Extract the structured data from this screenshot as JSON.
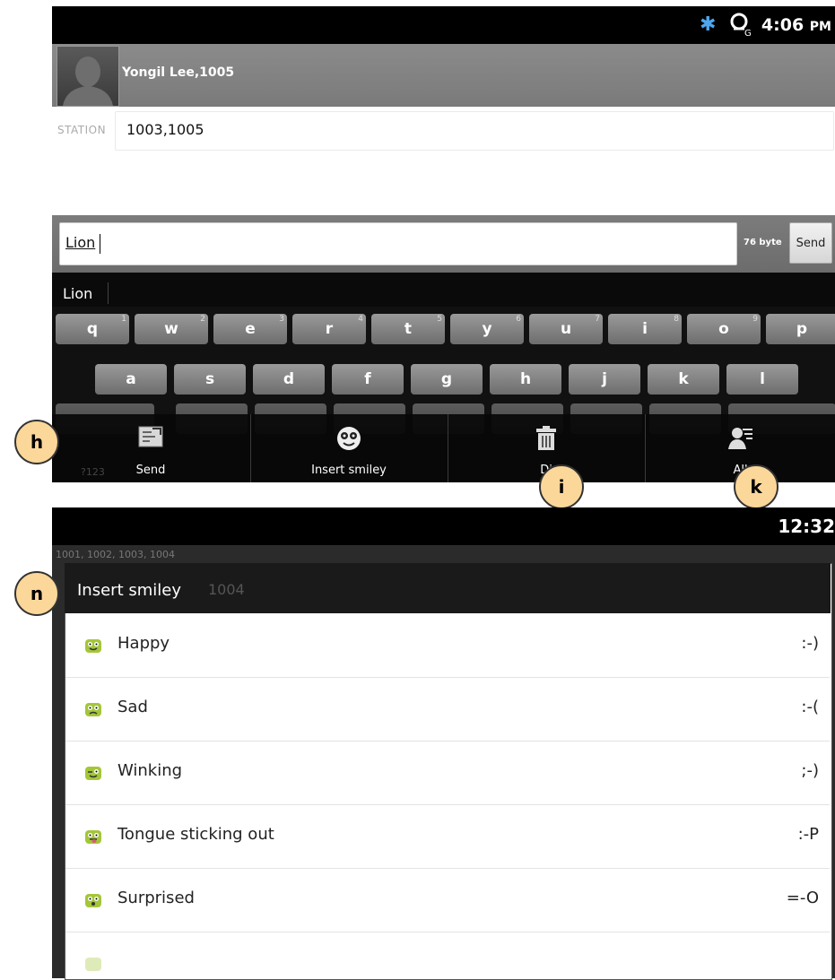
{
  "status_bar": {
    "time": "4:06",
    "ampm": "PM"
  },
  "contact": {
    "name": "Yongil Lee,1005"
  },
  "station": {
    "label": "STATION",
    "value": "1003,1005"
  },
  "compose": {
    "message": "Lion",
    "byte_count": "76 byte",
    "send_label": "Send"
  },
  "suggestion": {
    "word": "Lion"
  },
  "keyboard": {
    "row1": [
      {
        "key": "q",
        "num": "1"
      },
      {
        "key": "w",
        "num": "2"
      },
      {
        "key": "e",
        "num": "3"
      },
      {
        "key": "r",
        "num": "4"
      },
      {
        "key": "t",
        "num": "5"
      },
      {
        "key": "y",
        "num": "6"
      },
      {
        "key": "u",
        "num": "7"
      },
      {
        "key": "i",
        "num": "8"
      },
      {
        "key": "o",
        "num": "9"
      },
      {
        "key": "p",
        "num": ""
      }
    ],
    "row2": [
      "a",
      "s",
      "d",
      "f",
      "g",
      "h",
      "j",
      "k",
      "l"
    ],
    "symbols_key": "?123"
  },
  "options_menu": {
    "items": [
      {
        "label": "Send",
        "icon": "send-message-icon"
      },
      {
        "label": "Insert smiley",
        "icon": "smiley-icon"
      },
      {
        "label": "Di",
        "icon": "trash-icon"
      },
      {
        "label": "All",
        "icon": "contacts-icon"
      }
    ]
  },
  "callouts": {
    "h": "h",
    "i": "i",
    "k": "k",
    "n": "n"
  },
  "status_bar_2": {
    "time": "12:32"
  },
  "background_hint": {
    "recipients": "1001, 1002, 1003, 1004",
    "recipients_field": "1004"
  },
  "smiley_dialog": {
    "title": "Insert smiley",
    "items": [
      {
        "name": "Happy",
        "code": ":-)"
      },
      {
        "name": "Sad",
        "code": ":-("
      },
      {
        "name": "Winking",
        "code": ";-)"
      },
      {
        "name": "Tongue sticking out",
        "code": ":-P"
      },
      {
        "name": "Surprised",
        "code": "=-O"
      }
    ]
  },
  "colors": {
    "accent_blue": "#4fa6ee",
    "callout_fill": "#fcd79a",
    "smiley_green": "#a4c639"
  }
}
